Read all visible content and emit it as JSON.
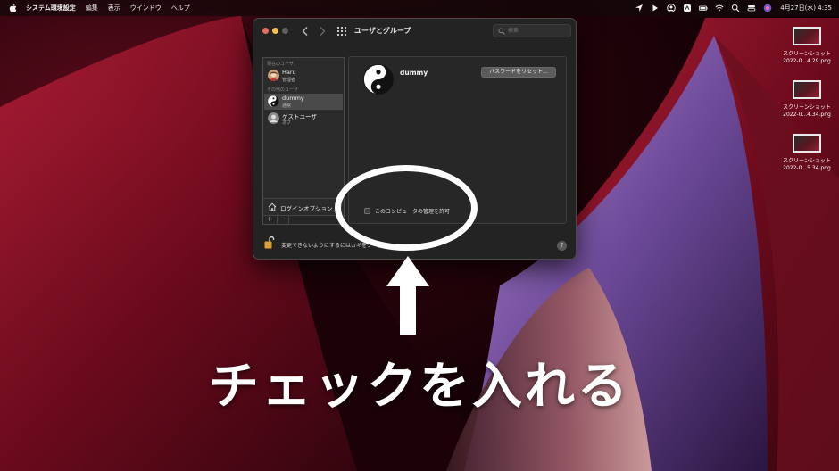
{
  "menubar": {
    "items": [
      "システム環境設定",
      "編集",
      "表示",
      "ウインドウ",
      "ヘルプ"
    ],
    "clock": "4月27日(水) 4:35"
  },
  "desktop": {
    "icons": [
      {
        "line1": "スクリーンショット",
        "line2": "2022-0...4.29.png"
      },
      {
        "line1": "スクリーンショット",
        "line2": "2022-0...4.34.png"
      },
      {
        "line1": "スクリーンショット",
        "line2": "2022-0...5.34.png"
      }
    ]
  },
  "window": {
    "title": "ユーザとグループ",
    "search_placeholder": "検索"
  },
  "sidebar": {
    "current_label": "現在のユーザ",
    "other_label": "その他のユーザ",
    "users": [
      {
        "name": "Haru",
        "role": "管理者"
      },
      {
        "name": "dummy",
        "role": "通常"
      },
      {
        "name": "ゲストユーザ",
        "role": "オフ"
      }
    ],
    "login_options": "ログインオプション",
    "add": "+",
    "remove": "−"
  },
  "detail": {
    "name": "dummy",
    "reset_password": "パスワードをリセット...",
    "allow_admin": "このコンピュータの管理を許可",
    "allow_admin_checked": false
  },
  "footer": {
    "lock_text": "変更できないようにするにはカギをク",
    "help": "?"
  },
  "annotation": {
    "text": "チェックを入れる"
  },
  "colors": {
    "accent": "#ffffff",
    "window_bg": "#232323",
    "selected_row": "#4a4a4a",
    "wallpaper_red": "#8a1025"
  }
}
